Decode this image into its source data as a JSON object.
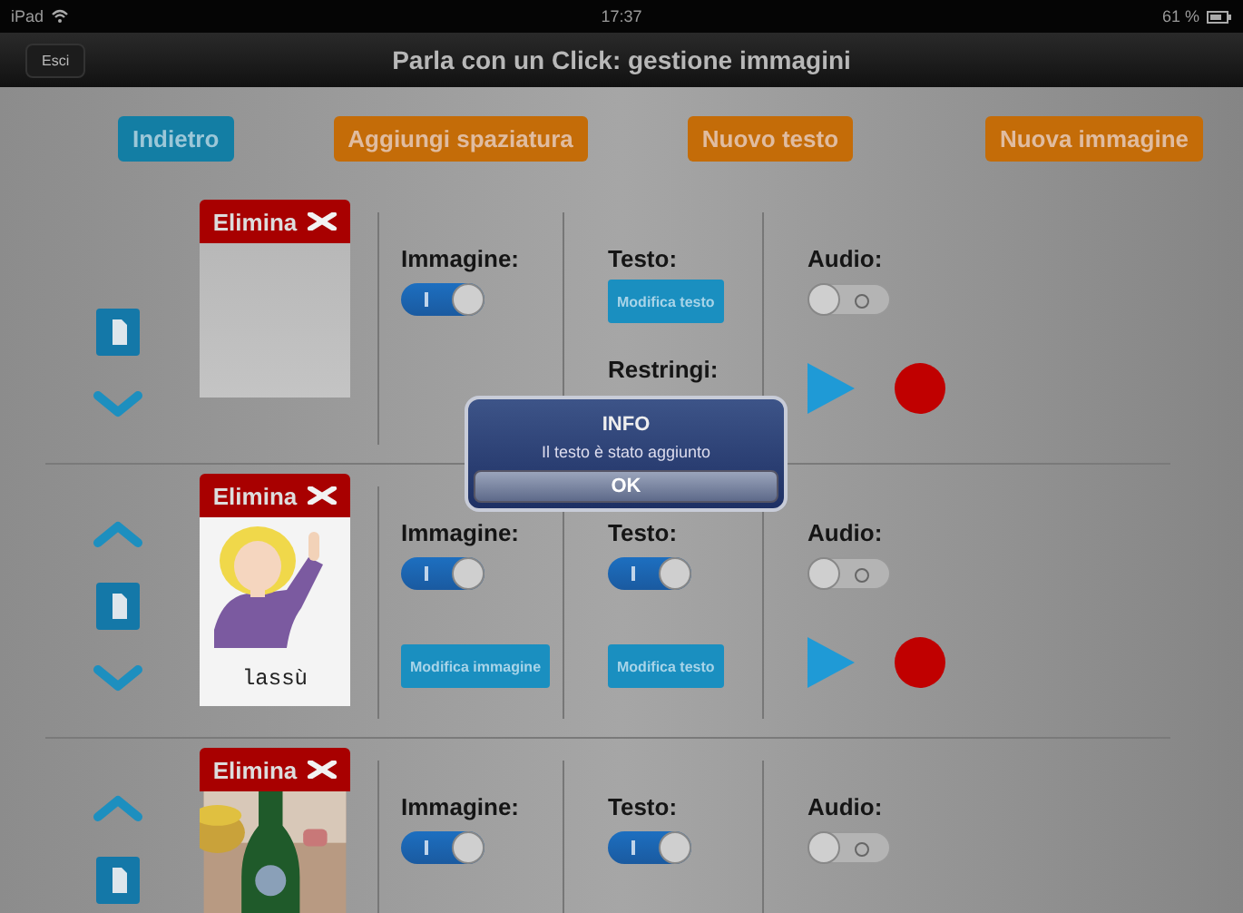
{
  "status_bar": {
    "device": "iPad",
    "time": "17:37",
    "battery": "61 %"
  },
  "nav_bar": {
    "back_button": "Esci",
    "title": "Parla con un Click: gestione immagini"
  },
  "toolbar": [
    {
      "label": "Indietro",
      "kind": "blue"
    },
    {
      "label": "Aggiungi spaziatura",
      "kind": "orange"
    },
    {
      "label": "Nuovo testo",
      "kind": "orange"
    },
    {
      "label": "Nuova immagine",
      "kind": "orange"
    }
  ],
  "rows": [
    {
      "move_up": false,
      "move_down": true,
      "delete": "Elimina",
      "image": {
        "kind": "blank"
      },
      "image_label": "Immagine:",
      "image_on": true,
      "text_label": "Testo:",
      "text_button": "Modifica testo",
      "shrink_label": "Restringi:",
      "audio_label": "Audio:",
      "audio_on": false,
      "audio_controls": true
    },
    {
      "move_up": true,
      "move_down": true,
      "delete": "Elimina",
      "image": {
        "kind": "drawing",
        "caption": "lassù"
      },
      "image_label": "Immagine:",
      "image_on": true,
      "image_button": "Modifica immagine",
      "text_label": "Testo:",
      "text_on": true,
      "text_button": "Modifica testo",
      "audio_label": "Audio:",
      "audio_on": false,
      "audio_controls": true
    },
    {
      "move_up": true,
      "move_down": false,
      "delete": "Elimina",
      "image_label": "Immagine:",
      "image_on": true,
      "text_label": "Testo:",
      "text_on": true,
      "audio_label": "Audio:",
      "audio_on": false,
      "audio_controls": false
    }
  ],
  "dialog": {
    "title": "INFO",
    "message": "Il testo è stato aggiunto",
    "button": "OK"
  }
}
